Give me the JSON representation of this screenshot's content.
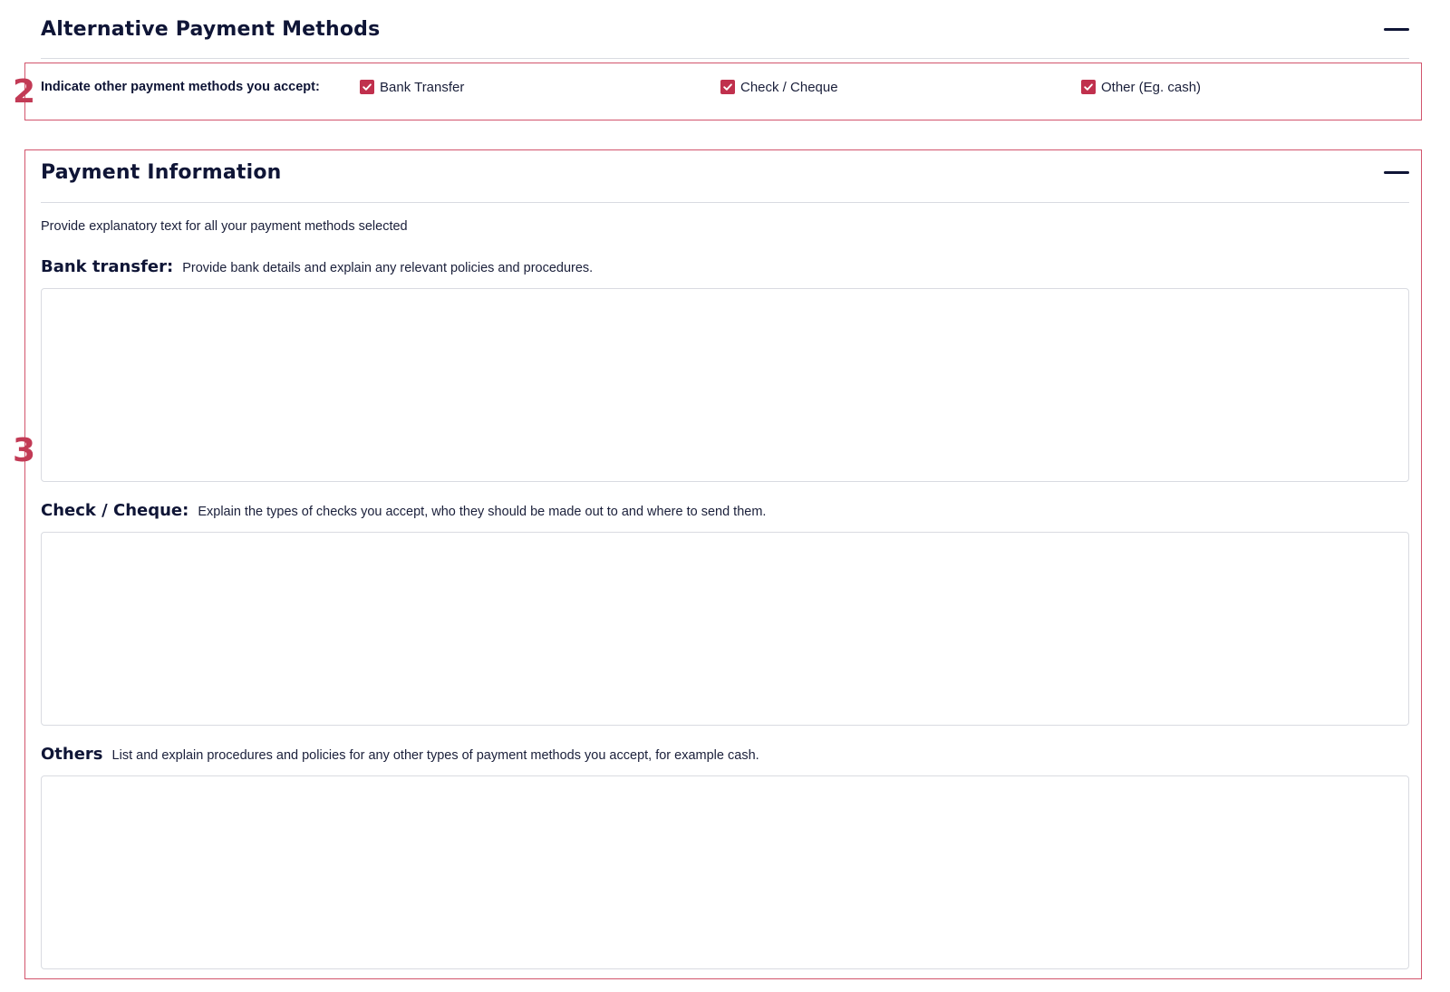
{
  "alt_methods": {
    "title": "Alternative Payment Methods",
    "collapse_icon": "minus-icon",
    "prompt": "Indicate other payment methods you accept:",
    "options": [
      {
        "label": "Bank Transfer",
        "checked": true
      },
      {
        "label": "Check / Cheque",
        "checked": true
      },
      {
        "label": "Other (Eg. cash)",
        "checked": true
      }
    ]
  },
  "payment_info": {
    "title": "Payment Information",
    "collapse_icon": "minus-icon",
    "intro": "Provide explanatory text for all your payment methods selected",
    "fields": [
      {
        "label": "Bank transfer:",
        "help": "Provide bank details and explain any relevant policies and procedures.",
        "value": ""
      },
      {
        "label": "Check / Cheque:",
        "help": "Explain the types of checks you accept, who they should be made out to and where to send them.",
        "value": ""
      },
      {
        "label": "Others",
        "help": "List and explain procedures and policies for any other types of payment methods you accept, for example cash.",
        "value": ""
      }
    ]
  },
  "annotations": {
    "one": "2",
    "two": "3"
  },
  "colors": {
    "accent": "#c0304d",
    "annotation": "#d2546c",
    "text": "#0f1536"
  }
}
